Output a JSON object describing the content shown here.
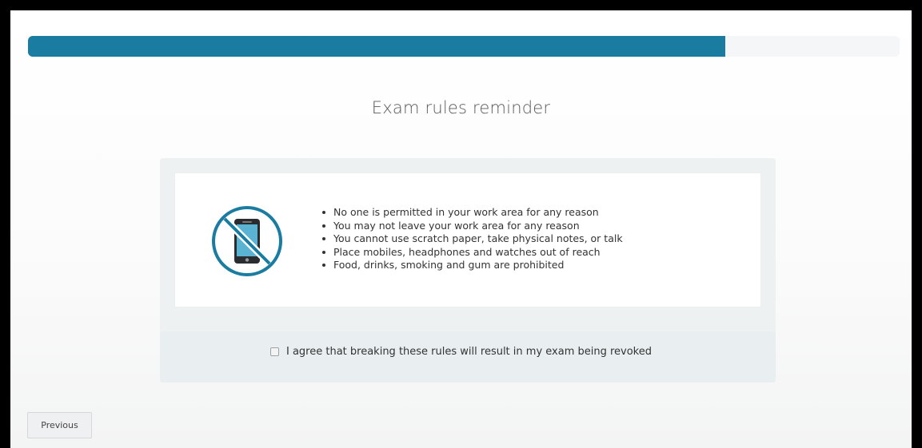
{
  "progress": {
    "fraction": 0.8,
    "color": "#1a7ca1"
  },
  "page_title": "Exam rules reminder",
  "rules": {
    "icon": "no-phone-icon",
    "icon_color": "#1a7ca1",
    "items": [
      "No one is permitted in your work area for any reason",
      "You may not leave your work area for any reason",
      "You cannot use scratch paper, take physical notes, or talk",
      "Place mobiles, headphones and watches out of reach",
      "Food, drinks, smoking and gum are prohibited"
    ]
  },
  "agreement": {
    "label": "I agree that breaking these rules will result in my exam being revoked",
    "checked": false
  },
  "nav": {
    "previous_label": "Previous"
  }
}
